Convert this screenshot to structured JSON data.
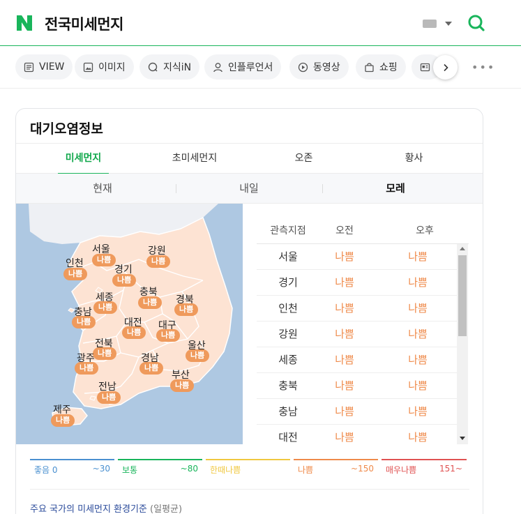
{
  "search": {
    "query": "전국미세먼지"
  },
  "tabs": [
    {
      "label": "VIEW",
      "icon": "view-icon"
    },
    {
      "label": "이미지",
      "icon": "image-icon"
    },
    {
      "label": "지식iN",
      "icon": "kin-icon"
    },
    {
      "label": "인플루언서",
      "icon": "person-icon"
    },
    {
      "label": "동영상",
      "icon": "play-icon"
    },
    {
      "label": "쇼핑",
      "icon": "bag-icon"
    }
  ],
  "card": {
    "title": "대기오염정보",
    "pollutant_tabs": [
      "미세먼지",
      "초미세먼지",
      "오존",
      "황사"
    ],
    "active_pollutant": "미세먼지",
    "day_tabs": [
      "현재",
      "내일",
      "모레"
    ],
    "active_day": "모레"
  },
  "map": {
    "regions": [
      {
        "name": "서울",
        "status": "나쁨"
      },
      {
        "name": "강원",
        "status": "나쁨"
      },
      {
        "name": "인천",
        "status": "나쁨"
      },
      {
        "name": "경기",
        "status": "나쁨"
      },
      {
        "name": "세종",
        "status": "나쁨"
      },
      {
        "name": "충북",
        "status": "나쁨"
      },
      {
        "name": "경북",
        "status": "나쁨"
      },
      {
        "name": "충남",
        "status": "나쁨"
      },
      {
        "name": "대전",
        "status": "나쁨"
      },
      {
        "name": "대구",
        "status": "나쁨"
      },
      {
        "name": "전북",
        "status": "나쁨"
      },
      {
        "name": "울산",
        "status": "나쁨"
      },
      {
        "name": "광주",
        "status": "나쁨"
      },
      {
        "name": "경남",
        "status": "나쁨"
      },
      {
        "name": "부산",
        "status": "나쁨"
      },
      {
        "name": "전남",
        "status": "나쁨"
      },
      {
        "name": "제주",
        "status": "나쁨"
      }
    ]
  },
  "table": {
    "headers": [
      "관측지점",
      "오전",
      "오후"
    ],
    "rows": [
      {
        "region": "서울",
        "am": "나쁨",
        "pm": "나쁨"
      },
      {
        "region": "경기",
        "am": "나쁨",
        "pm": "나쁨"
      },
      {
        "region": "인천",
        "am": "나쁨",
        "pm": "나쁨"
      },
      {
        "region": "강원",
        "am": "나쁨",
        "pm": "나쁨"
      },
      {
        "region": "세종",
        "am": "나쁨",
        "pm": "나쁨"
      },
      {
        "region": "충북",
        "am": "나쁨",
        "pm": "나쁨"
      },
      {
        "region": "충남",
        "am": "나쁨",
        "pm": "나쁨"
      },
      {
        "region": "대전",
        "am": "나쁨",
        "pm": "나쁨"
      }
    ]
  },
  "legend": [
    {
      "name": "좋음 0",
      "range": "~30",
      "color": "#4a90d0"
    },
    {
      "name": "보통",
      "range": "~80",
      "color": "#19b55b"
    },
    {
      "name": "한때나쁨",
      "range": "",
      "color": "#f0c840"
    },
    {
      "name": "나쁨",
      "range": "~150",
      "color": "#ef8a4a"
    },
    {
      "name": "매우나쁨",
      "range": "151~",
      "color": "#e05252"
    }
  ],
  "standard": {
    "link": "주요 국가의 미세먼지 환경기준",
    "note": "(일평균)"
  },
  "colors": {
    "brand": "#19b55b",
    "bad": "#ef8a4a",
    "land": "#fde3d3",
    "sea": "#aec8e2"
  }
}
